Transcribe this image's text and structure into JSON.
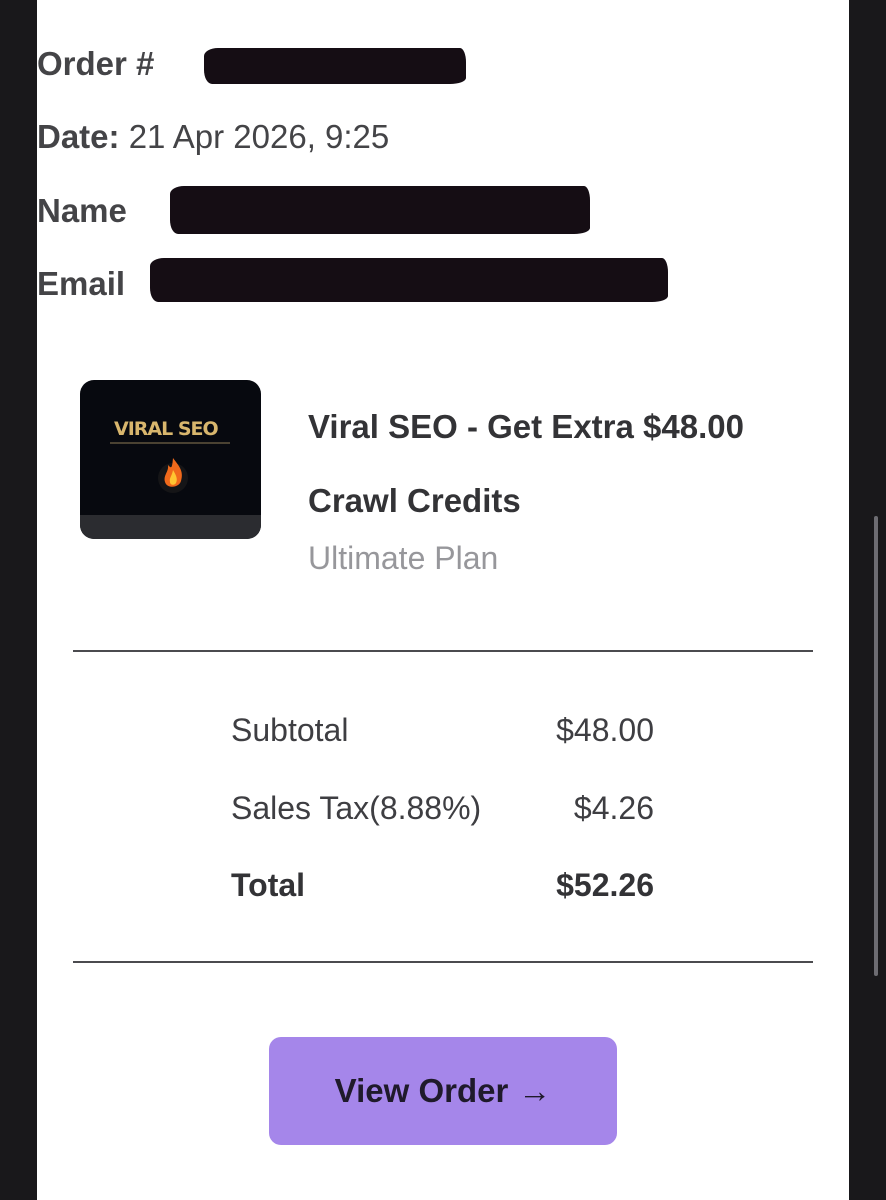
{
  "order": {
    "order_label": "Order #",
    "date_label": "Date:",
    "date_value": "21 Apr 2026, 9:25",
    "name_label": "Name",
    "email_label": "Email"
  },
  "product": {
    "thumbnail_text": "VIRAL SEO",
    "title": "Viral SEO - Get Extra $48.00 Crawl Credits",
    "plan": "Ultimate Plan",
    "thumbnail_icon": "flame-icon"
  },
  "summary": {
    "subtotal_label": "Subtotal",
    "subtotal_value": "$48.00",
    "tax_label": "Sales Tax(8.88%)",
    "tax_value": "$4.26",
    "total_label": "Total",
    "total_value": "$52.26"
  },
  "button": {
    "label": "View Order",
    "arrow": "→"
  },
  "colors": {
    "button_bg": "#a586ea",
    "page_bg": "#ffffff",
    "frame_bg": "#19181b"
  }
}
